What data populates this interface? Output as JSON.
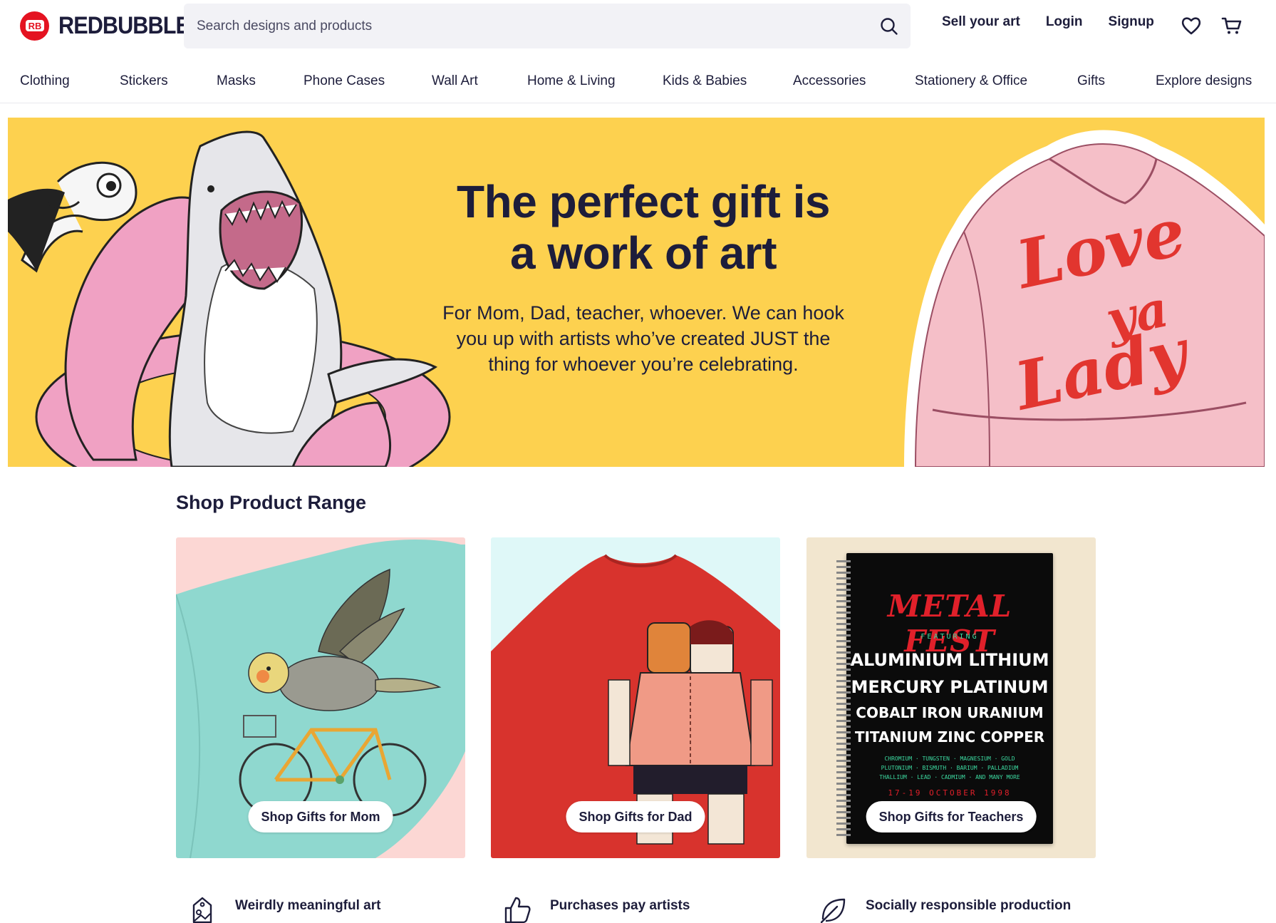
{
  "header": {
    "logo_text": "REDBUBBLE",
    "search_placeholder": "Search designs and products",
    "links": {
      "sell": "Sell your art",
      "login": "Login",
      "signup": "Signup"
    }
  },
  "nav": {
    "items": [
      "Clothing",
      "Stickers",
      "Masks",
      "Phone Cases",
      "Wall Art",
      "Home & Living",
      "Kids & Babies",
      "Accessories",
      "Stationery & Office",
      "Gifts",
      "Explore designs"
    ]
  },
  "hero": {
    "title_line1": "The perfect gift is",
    "title_line2": "a work of art",
    "subtitle": "For Mom, Dad, teacher, whoever. We can hook you up with artists who’ve created JUST the thing for whoever you’re celebrating.",
    "jacket_text": [
      "Love",
      "ya",
      "Lady"
    ]
  },
  "shop_range": {
    "title": "Shop Product Range",
    "cards": [
      {
        "label": "Shop Gifts for Mom"
      },
      {
        "label": "Shop Gifts for Dad"
      },
      {
        "label": "Shop Gifts for Teachers"
      }
    ],
    "notebook": {
      "headline": "METAL FEST",
      "featuring": "FEATURING",
      "lines": [
        "ALUMINIUM LITHIUM",
        "MERCURY PLATINUM",
        "COBALT IRON URANIUM",
        "TITANIUM ZINC COPPER"
      ],
      "small_lines": [
        "CHROMIUM · TUNGSTEN · MAGNESIUM · GOLD",
        "PLUTONIUM · BISMUTH · BARIUM · PALLADIUM",
        "THALLIUM · LEAD · CADMIUM · AND MANY MORE"
      ],
      "date": "17-19 OCTOBER 1998"
    }
  },
  "value_props": [
    {
      "title": "Weirdly meaningful art",
      "icon": "tag-icon"
    },
    {
      "title": "Purchases pay artists",
      "icon": "thumbs-up-icon"
    },
    {
      "title": "Socially responsible production",
      "icon": "leaf-icon"
    }
  ],
  "colors": {
    "brand_red": "#e41321",
    "hero_yellow": "#fdd14f",
    "text_navy": "#1d1d3b"
  }
}
